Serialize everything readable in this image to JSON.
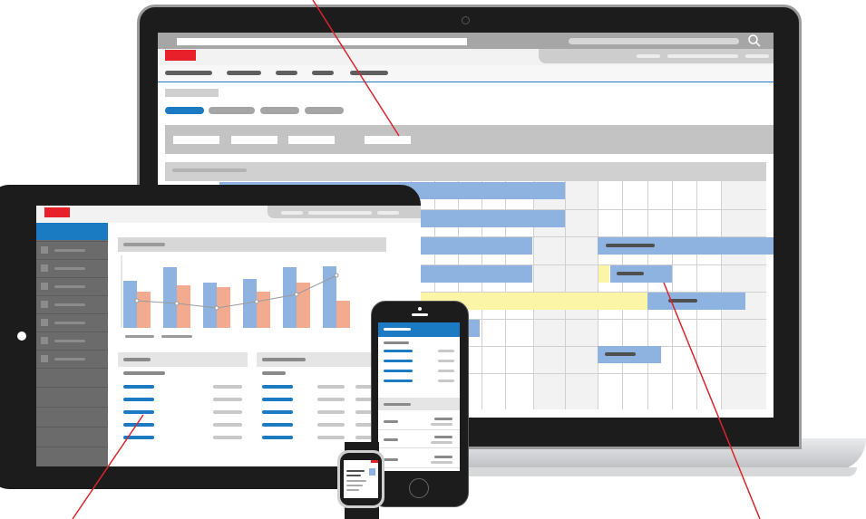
{
  "theme": {
    "accent": "#e8202a",
    "blue": "#1a7ac2",
    "gantt_blue": "#8eb3e0",
    "gantt_yellow": "#fbf5a8",
    "chart_orange": "#f3ab8f",
    "bezel": "#1c1c1c",
    "gray": "#a7a7a7"
  },
  "icons": [
    "search-icon",
    "camera-icon",
    "home-button-icon"
  ],
  "devices": [
    "laptop",
    "tablet",
    "phone",
    "watch"
  ],
  "chart_data": {
    "type": "bar",
    "categories": [
      "",
      "",
      "",
      "",
      "",
      ""
    ],
    "series": [
      {
        "values": [
          52,
          67,
          50,
          54,
          67,
          68
        ]
      },
      {
        "values": [
          40,
          47,
          45,
          40,
          50,
          30
        ]
      },
      {
        "values": [
          30,
          27,
          22,
          29,
          37,
          58
        ]
      }
    ],
    "title": "",
    "xlabel": "",
    "ylabel": "",
    "ylim": [
      0,
      80
    ]
  }
}
